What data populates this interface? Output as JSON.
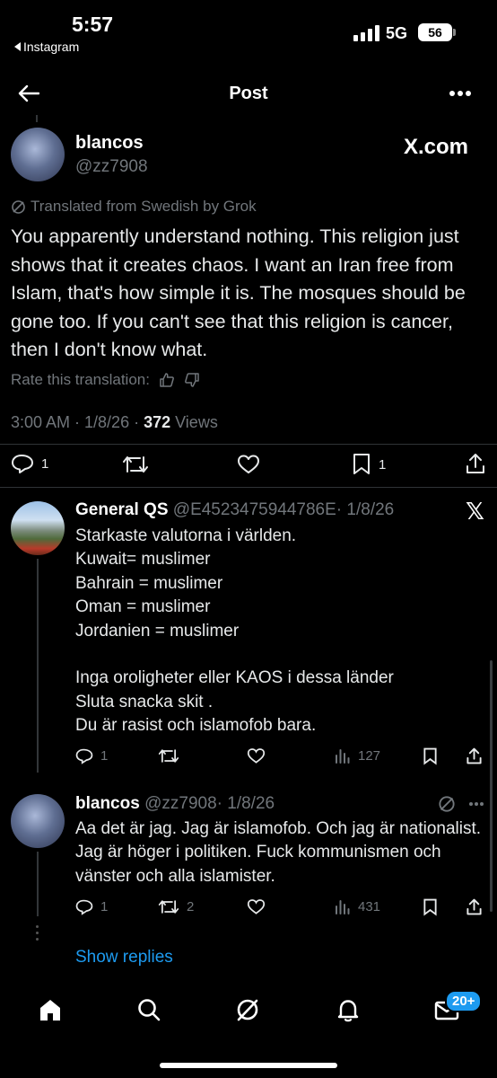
{
  "status": {
    "time": "5:57",
    "back_app": "Instagram",
    "network": "5G",
    "battery": "56"
  },
  "header": {
    "title": "Post"
  },
  "main_post": {
    "name": "blancos",
    "handle": "@zz7908",
    "brand": "X.com",
    "translated_label": "Translated from Swedish by Grok",
    "text": "You apparently understand nothing. This religion just shows that it creates chaos. I want an Iran free from Islam, that's how simple it is. The mosques should be gone too. If you can't see that this religion is cancer, then I don't know what.",
    "rate_label": "Rate this translation:",
    "timestamp": "3:00 AM · 1/8/26 · ",
    "views_count": "372",
    "views_label": " Views",
    "replies": "1",
    "bookmarks": "1"
  },
  "reply1": {
    "name": "General QS",
    "handle": "@E4523475944786E",
    "date": "· 1/8/26",
    "lines": [
      "Starkaste valutorna i världen.",
      "Kuwait= muslimer",
      "Bahrain = muslimer",
      "Oman = muslimer",
      "Jordanien = muslimer",
      "",
      "Inga oroligheter eller KAOS i dessa länder",
      "Sluta snacka skit .",
      "Du är rasist och islamofob bara."
    ],
    "replies": "1",
    "views": "127"
  },
  "reply2": {
    "name": "blancos",
    "handle": "@zz7908",
    "date": "· 1/8/26",
    "text": "Aa det är jag. Jag är islamofob. Och jag är nationalist. Jag är höger i politiken. Fuck kommunismen och vänster och alla islamister.",
    "replies": "1",
    "reposts": "2",
    "views": "431"
  },
  "show_replies": "Show replies",
  "bottom_nav": {
    "messages_badge": "20+"
  },
  "colors": {
    "background": "#000000",
    "text": "#e7e9ea",
    "muted": "#71767b",
    "link": "#1d9bf0"
  }
}
